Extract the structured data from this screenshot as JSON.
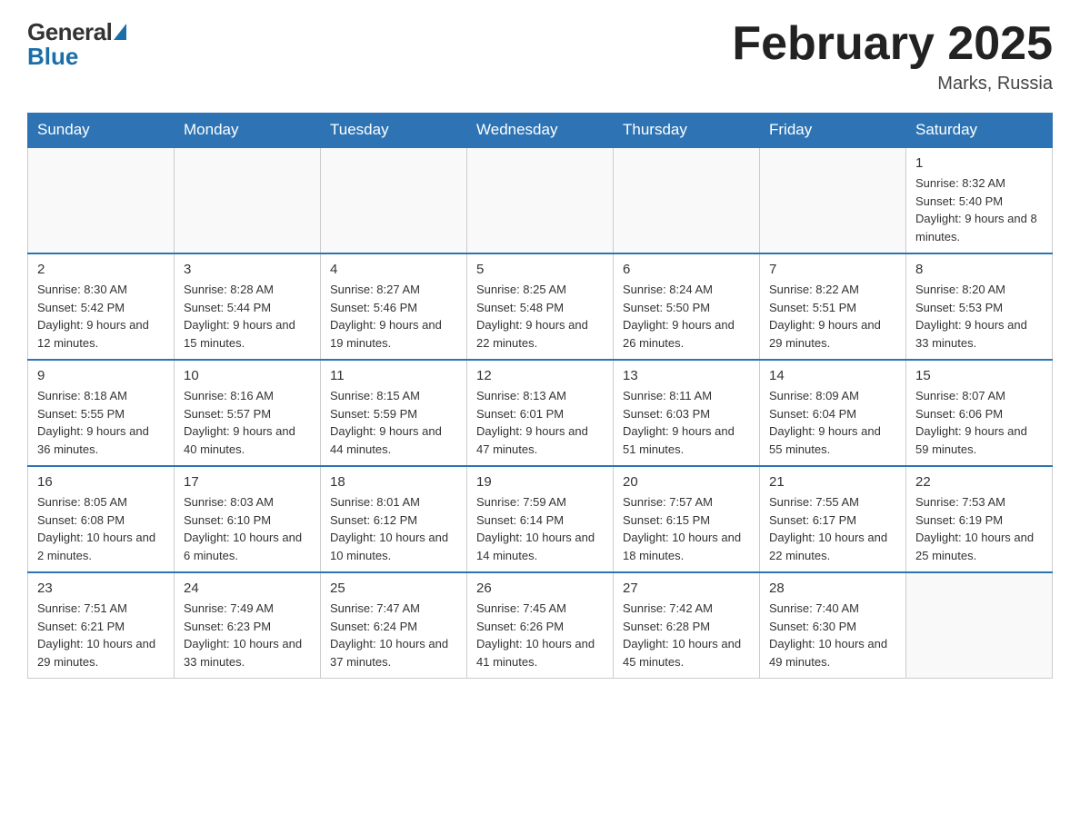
{
  "logo": {
    "general": "General",
    "blue": "Blue"
  },
  "header": {
    "title": "February 2025",
    "location": "Marks, Russia"
  },
  "days_of_week": [
    "Sunday",
    "Monday",
    "Tuesday",
    "Wednesday",
    "Thursday",
    "Friday",
    "Saturday"
  ],
  "weeks": [
    [
      null,
      null,
      null,
      null,
      null,
      null,
      {
        "day": "1",
        "sunrise": "Sunrise: 8:32 AM",
        "sunset": "Sunset: 5:40 PM",
        "daylight": "Daylight: 9 hours and 8 minutes."
      }
    ],
    [
      {
        "day": "2",
        "sunrise": "Sunrise: 8:30 AM",
        "sunset": "Sunset: 5:42 PM",
        "daylight": "Daylight: 9 hours and 12 minutes."
      },
      {
        "day": "3",
        "sunrise": "Sunrise: 8:28 AM",
        "sunset": "Sunset: 5:44 PM",
        "daylight": "Daylight: 9 hours and 15 minutes."
      },
      {
        "day": "4",
        "sunrise": "Sunrise: 8:27 AM",
        "sunset": "Sunset: 5:46 PM",
        "daylight": "Daylight: 9 hours and 19 minutes."
      },
      {
        "day": "5",
        "sunrise": "Sunrise: 8:25 AM",
        "sunset": "Sunset: 5:48 PM",
        "daylight": "Daylight: 9 hours and 22 minutes."
      },
      {
        "day": "6",
        "sunrise": "Sunrise: 8:24 AM",
        "sunset": "Sunset: 5:50 PM",
        "daylight": "Daylight: 9 hours and 26 minutes."
      },
      {
        "day": "7",
        "sunrise": "Sunrise: 8:22 AM",
        "sunset": "Sunset: 5:51 PM",
        "daylight": "Daylight: 9 hours and 29 minutes."
      },
      {
        "day": "8",
        "sunrise": "Sunrise: 8:20 AM",
        "sunset": "Sunset: 5:53 PM",
        "daylight": "Daylight: 9 hours and 33 minutes."
      }
    ],
    [
      {
        "day": "9",
        "sunrise": "Sunrise: 8:18 AM",
        "sunset": "Sunset: 5:55 PM",
        "daylight": "Daylight: 9 hours and 36 minutes."
      },
      {
        "day": "10",
        "sunrise": "Sunrise: 8:16 AM",
        "sunset": "Sunset: 5:57 PM",
        "daylight": "Daylight: 9 hours and 40 minutes."
      },
      {
        "day": "11",
        "sunrise": "Sunrise: 8:15 AM",
        "sunset": "Sunset: 5:59 PM",
        "daylight": "Daylight: 9 hours and 44 minutes."
      },
      {
        "day": "12",
        "sunrise": "Sunrise: 8:13 AM",
        "sunset": "Sunset: 6:01 PM",
        "daylight": "Daylight: 9 hours and 47 minutes."
      },
      {
        "day": "13",
        "sunrise": "Sunrise: 8:11 AM",
        "sunset": "Sunset: 6:03 PM",
        "daylight": "Daylight: 9 hours and 51 minutes."
      },
      {
        "day": "14",
        "sunrise": "Sunrise: 8:09 AM",
        "sunset": "Sunset: 6:04 PM",
        "daylight": "Daylight: 9 hours and 55 minutes."
      },
      {
        "day": "15",
        "sunrise": "Sunrise: 8:07 AM",
        "sunset": "Sunset: 6:06 PM",
        "daylight": "Daylight: 9 hours and 59 minutes."
      }
    ],
    [
      {
        "day": "16",
        "sunrise": "Sunrise: 8:05 AM",
        "sunset": "Sunset: 6:08 PM",
        "daylight": "Daylight: 10 hours and 2 minutes."
      },
      {
        "day": "17",
        "sunrise": "Sunrise: 8:03 AM",
        "sunset": "Sunset: 6:10 PM",
        "daylight": "Daylight: 10 hours and 6 minutes."
      },
      {
        "day": "18",
        "sunrise": "Sunrise: 8:01 AM",
        "sunset": "Sunset: 6:12 PM",
        "daylight": "Daylight: 10 hours and 10 minutes."
      },
      {
        "day": "19",
        "sunrise": "Sunrise: 7:59 AM",
        "sunset": "Sunset: 6:14 PM",
        "daylight": "Daylight: 10 hours and 14 minutes."
      },
      {
        "day": "20",
        "sunrise": "Sunrise: 7:57 AM",
        "sunset": "Sunset: 6:15 PM",
        "daylight": "Daylight: 10 hours and 18 minutes."
      },
      {
        "day": "21",
        "sunrise": "Sunrise: 7:55 AM",
        "sunset": "Sunset: 6:17 PM",
        "daylight": "Daylight: 10 hours and 22 minutes."
      },
      {
        "day": "22",
        "sunrise": "Sunrise: 7:53 AM",
        "sunset": "Sunset: 6:19 PM",
        "daylight": "Daylight: 10 hours and 25 minutes."
      }
    ],
    [
      {
        "day": "23",
        "sunrise": "Sunrise: 7:51 AM",
        "sunset": "Sunset: 6:21 PM",
        "daylight": "Daylight: 10 hours and 29 minutes."
      },
      {
        "day": "24",
        "sunrise": "Sunrise: 7:49 AM",
        "sunset": "Sunset: 6:23 PM",
        "daylight": "Daylight: 10 hours and 33 minutes."
      },
      {
        "day": "25",
        "sunrise": "Sunrise: 7:47 AM",
        "sunset": "Sunset: 6:24 PM",
        "daylight": "Daylight: 10 hours and 37 minutes."
      },
      {
        "day": "26",
        "sunrise": "Sunrise: 7:45 AM",
        "sunset": "Sunset: 6:26 PM",
        "daylight": "Daylight: 10 hours and 41 minutes."
      },
      {
        "day": "27",
        "sunrise": "Sunrise: 7:42 AM",
        "sunset": "Sunset: 6:28 PM",
        "daylight": "Daylight: 10 hours and 45 minutes."
      },
      {
        "day": "28",
        "sunrise": "Sunrise: 7:40 AM",
        "sunset": "Sunset: 6:30 PM",
        "daylight": "Daylight: 10 hours and 49 minutes."
      },
      null
    ]
  ]
}
